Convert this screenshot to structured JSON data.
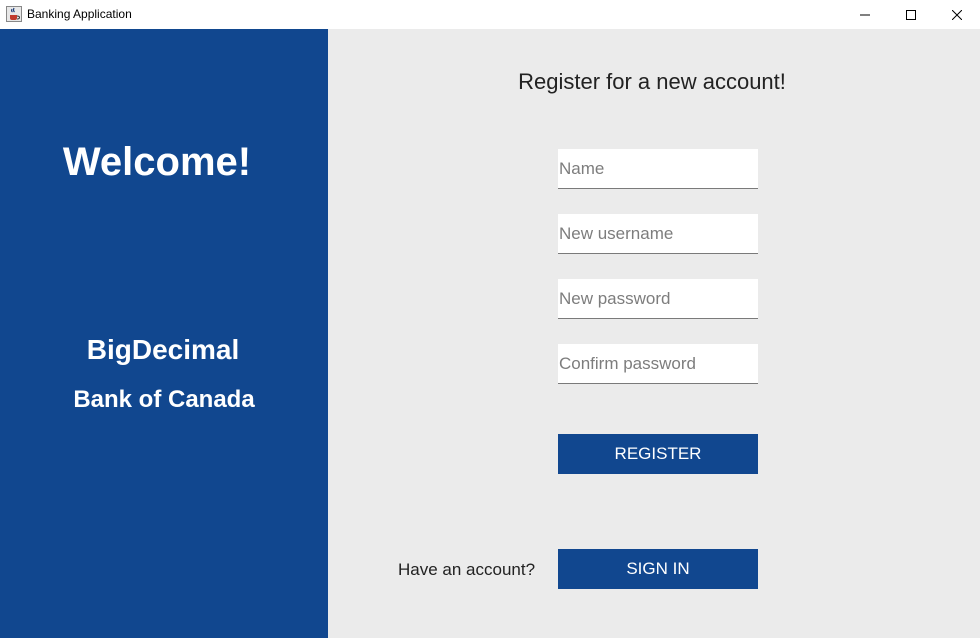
{
  "window": {
    "title": "Banking Application",
    "icon": "java-cup-icon"
  },
  "left_panel": {
    "welcome": "Welcome!",
    "brand_line1": "BigDecimal",
    "brand_line2": "Bank of Canada",
    "background_color": "#11478f"
  },
  "form": {
    "title": "Register for a new account!",
    "fields": {
      "name": {
        "placeholder": "Name",
        "value": ""
      },
      "username": {
        "placeholder": "New username",
        "value": ""
      },
      "password": {
        "placeholder": "New password",
        "value": ""
      },
      "confirm": {
        "placeholder": "Confirm password",
        "value": ""
      }
    },
    "register_label": "REGISTER",
    "have_account": "Have an account?",
    "signin_label": "SIGN IN",
    "accent_color": "#11478f"
  }
}
